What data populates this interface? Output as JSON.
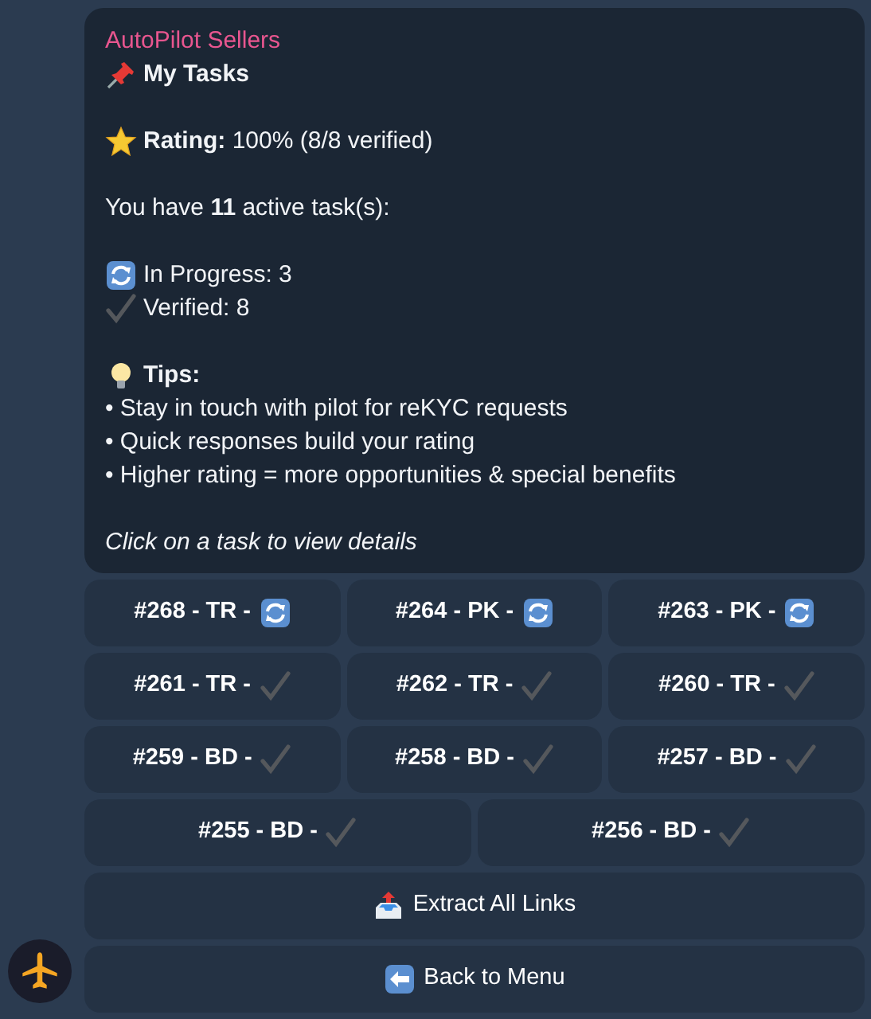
{
  "message": {
    "sender": "AutoPilot Sellers",
    "title": {
      "text": "My Tasks"
    },
    "rating": {
      "text": "**Rating:** 100% (8/8 verified)"
    },
    "summary": "You have **11** active task(s):",
    "statuses": [
      {
        "text": "In Progress: 3"
      },
      {
        "text": "Verified: 8"
      }
    ],
    "tips": {
      "heading": "Tips:",
      "items": [
        "• Stay in touch with pilot for reKYC requests",
        "• Quick responses build your rating",
        "• Higher rating = more opportunities & special benefits"
      ]
    },
    "footer": "Click on a task to view details"
  },
  "task_buttons": [
    [
      {
        "label": "#268 - TR -",
        "verified": false
      },
      {
        "label": "#264 - PK -",
        "verified": false
      },
      {
        "label": "#263 - PK -",
        "verified": false
      }
    ],
    [
      {
        "label": "#261 - TR -",
        "verified": true
      },
      {
        "label": "#262 - TR -",
        "verified": true
      },
      {
        "label": "#260 - TR -",
        "verified": true
      }
    ],
    [
      {
        "label": "#259 - BD -",
        "verified": true
      },
      {
        "label": "#258 - BD -",
        "verified": true
      },
      {
        "label": "#257 - BD -",
        "verified": true
      }
    ],
    [
      {
        "label": "#255 - BD -",
        "verified": true
      },
      {
        "label": "#256 - BD -",
        "verified": true
      }
    ]
  ],
  "action_buttons": [
    {
      "label": "Extract All Links"
    },
    {
      "label": "Back to Menu"
    }
  ]
}
